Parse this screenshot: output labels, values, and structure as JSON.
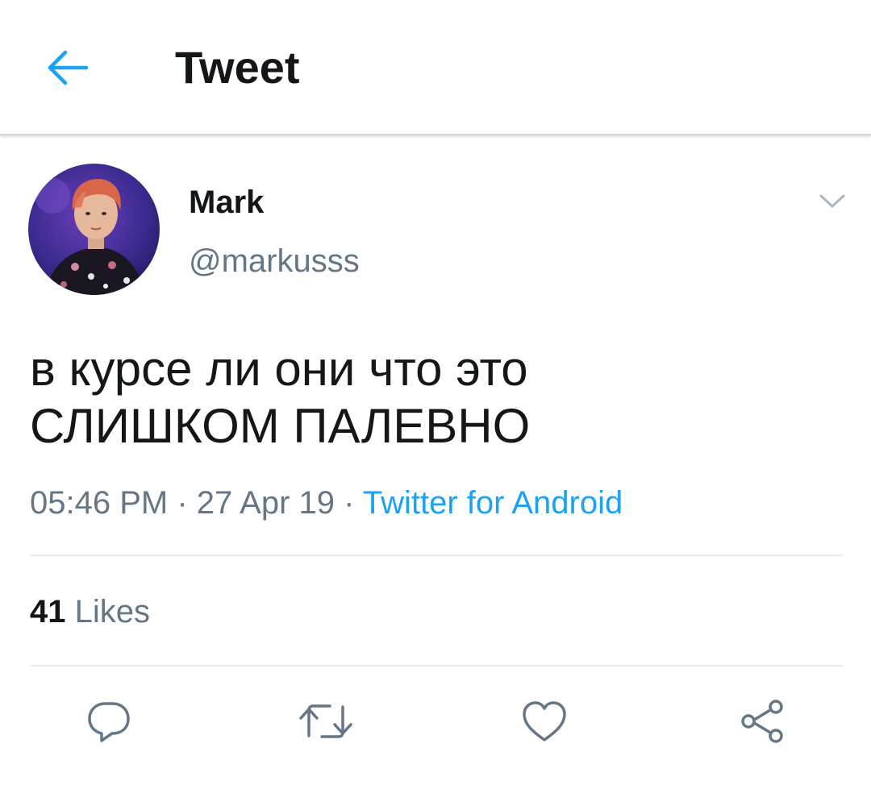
{
  "header": {
    "title": "Tweet",
    "back_icon": "arrow-left-icon"
  },
  "colors": {
    "accent": "#1da1f2",
    "text_primary": "#14171a",
    "text_secondary": "#657786",
    "divider": "#e6ecf0"
  },
  "tweet": {
    "author": {
      "display_name": "Mark",
      "handle": "@markusss"
    },
    "text": "в курсе ли они что это\nСЛИШКОМ ПАЛЕВНО",
    "time": "05:46 PM",
    "separator": " · ",
    "date": "27 Apr 19",
    "source": "Twitter for Android"
  },
  "stats": {
    "likes_count": "41",
    "likes_label": "Likes"
  },
  "actions": [
    {
      "icon": "reply-icon"
    },
    {
      "icon": "retweet-icon"
    },
    {
      "icon": "like-icon"
    },
    {
      "icon": "share-icon"
    }
  ]
}
